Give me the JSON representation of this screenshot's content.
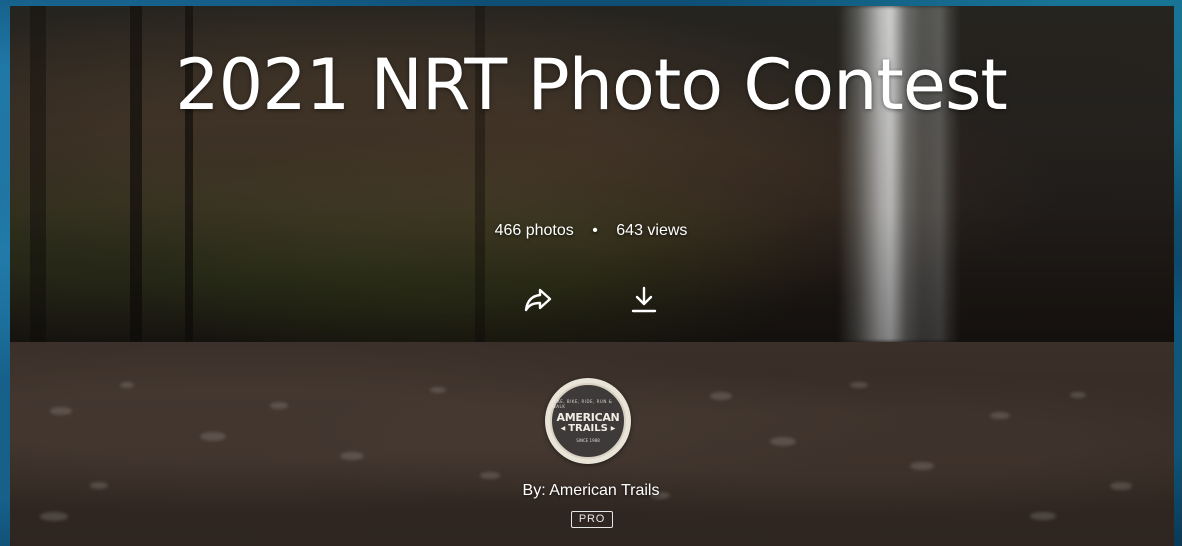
{
  "gallery": {
    "title": "2021 NRT Photo Contest",
    "photos_count": "466 photos",
    "separator": "•",
    "views_count": "643 views"
  },
  "actions": [
    {
      "icon": "share-icon"
    },
    {
      "icon": "download-icon"
    }
  ],
  "author": {
    "avatar_logo": {
      "top_text": "HIKE, BIKE, RIDE, RUN & WALK",
      "line1": "AMERICAN",
      "line2": "TRAILS",
      "bottom_text": "SINCE 1988"
    },
    "byline": "By: American Trails",
    "badge": "PRO"
  },
  "colors": {
    "text": "#ffffff",
    "page_background": "#0d3a5a",
    "badge_border": "#e6e6e6"
  }
}
